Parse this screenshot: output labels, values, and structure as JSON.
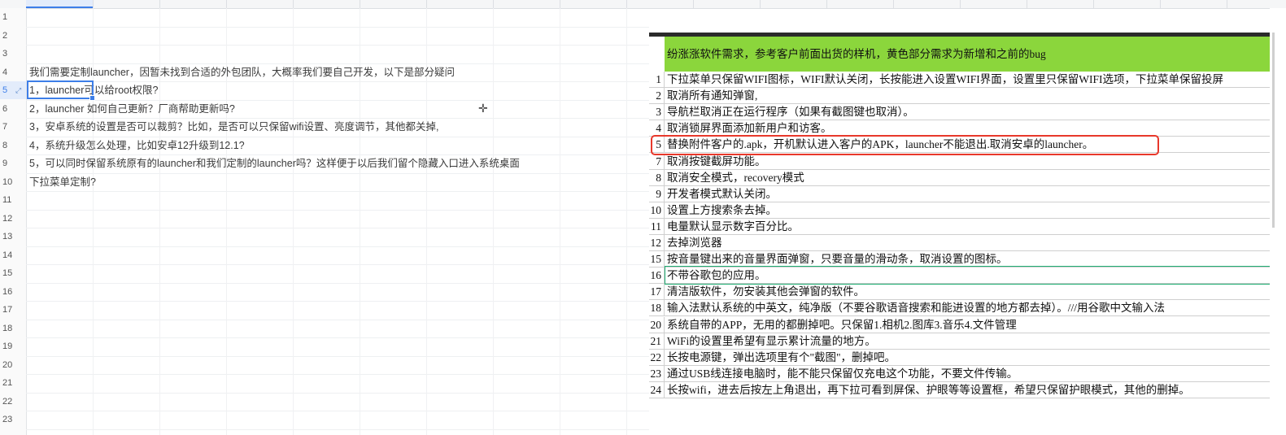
{
  "sheet": {
    "row_numbers": [
      "1",
      "2",
      "3",
      "4",
      "5",
      "6",
      "7",
      "8",
      "9",
      "10",
      "11",
      "12",
      "13",
      "14",
      "15",
      "16",
      "17",
      "18",
      "19",
      "20",
      "21",
      "22",
      "23"
    ],
    "active_row": "5",
    "cells": [
      {
        "row": 4,
        "text": "我们需要定制launcher，因暂未找到合适的外包团队，大概率我们要自己开发，以下是部分疑问"
      },
      {
        "row": 5,
        "text": "1，launcher可以给root权限?"
      },
      {
        "row": 6,
        "text": "2，launcher 如何自己更新？厂商帮助更新吗?"
      },
      {
        "row": 7,
        "text": "3，安卓系统的设置是否可以裁剪？比如，是否可以只保留wifi设置、亮度调节，其他都关掉,"
      },
      {
        "row": 8,
        "text": "4，系统升级怎么处理，比如安卓12升级到12.1?"
      },
      {
        "row": 9,
        "text": "5，可以同时保留系统原有的launcher和我们定制的launcher吗？这样便于以后我们留个隐藏入口进入系统桌面"
      },
      {
        "row": 10,
        "text": "下拉菜单定制?"
      }
    ]
  },
  "image_table": {
    "header": "纷涨涨软件需求，参考客户前面出货的样机，黄色部分需求为新增和之前的bug",
    "rows": [
      {
        "num": "1",
        "text": "下拉菜单只保留WIFI图标，WIFI默认关闭，长按能进入设置WIFI界面，设置里只保留WIFI选项，下拉菜单保留投屏"
      },
      {
        "num": "2",
        "text": "取消所有通知弹窗,"
      },
      {
        "num": "3",
        "text": "导航栏取消正在运行程序（如果有截图键也取消）。"
      },
      {
        "num": "4",
        "text": "取消锁屏界面添加新用户和访客。"
      },
      {
        "num": "5",
        "text": "替换附件客户的.apk，开机默认进入客户的APK，launcher不能退出.取消安卓的launcher。"
      },
      {
        "num": "7",
        "text": "取消按键截屏功能。"
      },
      {
        "num": "8",
        "text": "取消安全模式，recovery模式"
      },
      {
        "num": "9",
        "text": "开发者模式默认关闭。"
      },
      {
        "num": "10",
        "text": "设置上方搜索条去掉。"
      },
      {
        "num": "11",
        "text": "电量默认显示数字百分比。"
      },
      {
        "num": "12",
        "text": "去掉浏览器"
      },
      {
        "num": "15",
        "text": "按音量键出来的音量界面弹窗，只要音量的滑动条，取消设置的图标。"
      },
      {
        "num": "16",
        "text": "不带谷歌包的应用。"
      },
      {
        "num": "17",
        "text": "清洁版软件，勿安装其他会弹窗的软件。"
      },
      {
        "num": "18",
        "text": "输入法默认系统的中英文，纯净版（不要谷歌语音搜索和能进设置的地方都去掉）。///用谷歌中文输入法"
      },
      {
        "num": "20",
        "text": "系统自带的APP，无用的都删掉吧。只保留1.相机2.图库3.音乐4.文件管理"
      },
      {
        "num": "21",
        "text": "WiFi的设置里希望有显示累计流量的地方。"
      },
      {
        "num": "22",
        "text": "长按电源键，弹出选项里有个\"截图\"，删掉吧。"
      },
      {
        "num": "23",
        "text": "通过USB线连接电脑时，能不能只保留仅充电这个功能，不要文件传输。"
      },
      {
        "num": "24",
        "text": "长按wifi，进去后按左上角退出，再下拉可看到屏保、护眼等等设置框，希望只保留护眼模式，其他的删掉。"
      }
    ]
  },
  "colors": {
    "accent": "#3d7ee8",
    "header_green": "#8bd63c",
    "highlight_red": "#e8382b",
    "selection_green": "#1fae73"
  }
}
